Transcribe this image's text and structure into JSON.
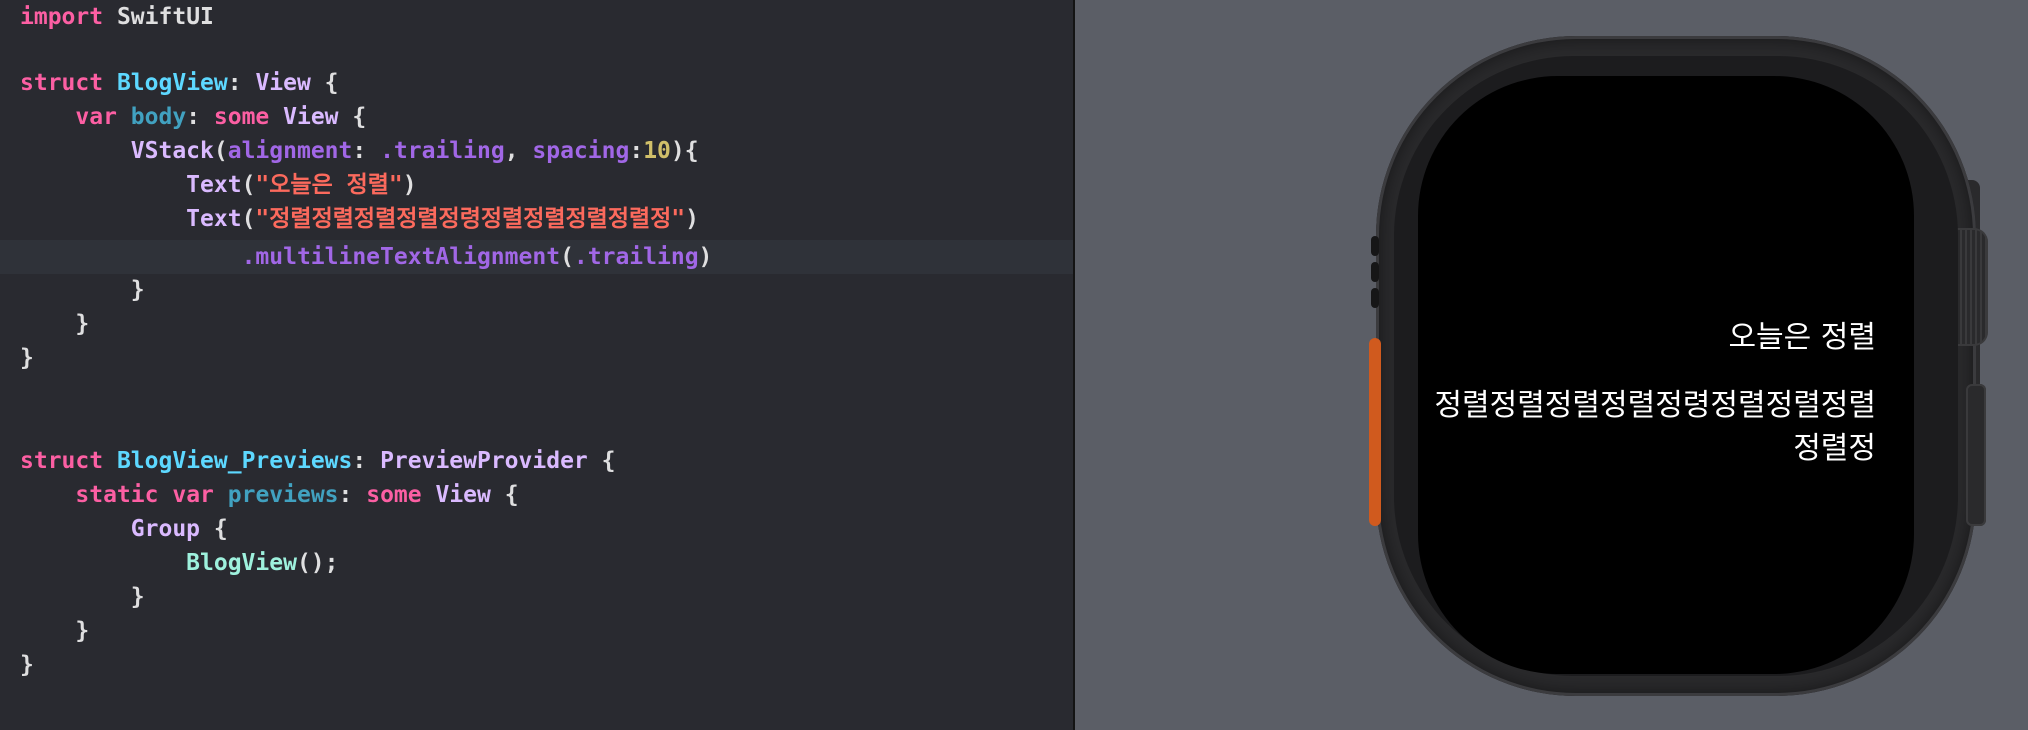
{
  "editor": {
    "lines": [
      {
        "kw": "import",
        "rest": "SwiftUI"
      },
      {
        "kw": "struct",
        "name": "BlogView",
        "colon": ": ",
        "proto": "View",
        "brace": " {"
      },
      {
        "kw": "var",
        "prop": "body",
        "colon": ": ",
        "kw2": "some",
        "proto": "View",
        "brace": " {"
      },
      {
        "call": "VStack",
        "p1": "(",
        "arg1": "alignment",
        "c1": ": ",
        "dot1": ".trailing",
        "comma": ", ",
        "arg2": "spacing",
        "c2": ":",
        "num": "10",
        "end": "){"
      },
      {
        "call": "Text",
        "open": "(",
        "str": "\"오늘은 정렬\"",
        "close": ")"
      },
      {
        "call": "Text",
        "open": "(",
        "str": "\"정렬정렬정렬정렬정령정렬정렬정렬정렬정\"",
        "close": ")"
      },
      {
        "mod": ".multilineTextAlignment",
        "open": "(",
        "arg": ".trailing",
        "close": ")"
      },
      {
        "brace": "}"
      },
      {
        "brace": "}"
      },
      {
        "brace": "}"
      },
      {
        "kw": "struct",
        "name": "BlogView_Previews",
        "colon": ": ",
        "proto": "PreviewProvider",
        "brace": " {"
      },
      {
        "kw": "static",
        "kw2": "var",
        "prop": "previews",
        "colon": ": ",
        "kw3": "some",
        "proto": "View",
        "brace": " {"
      },
      {
        "call": "Group",
        "brace": " {"
      },
      {
        "call": "BlogView",
        "end": "();"
      },
      {
        "brace": "}"
      },
      {
        "brace": "}"
      },
      {
        "brace": "}"
      }
    ]
  },
  "preview": {
    "text1": "오늘은 정렬",
    "text2": "정렬정렬정렬정렬정령정렬정렬정렬정렬정"
  },
  "colors": {
    "keyword": "#fc5fa3",
    "type": "#5dd8ff",
    "string": "#fc6a5d",
    "number": "#d0bf69",
    "editor_bg": "#292a30",
    "preview_bg": "#5b5e66"
  }
}
